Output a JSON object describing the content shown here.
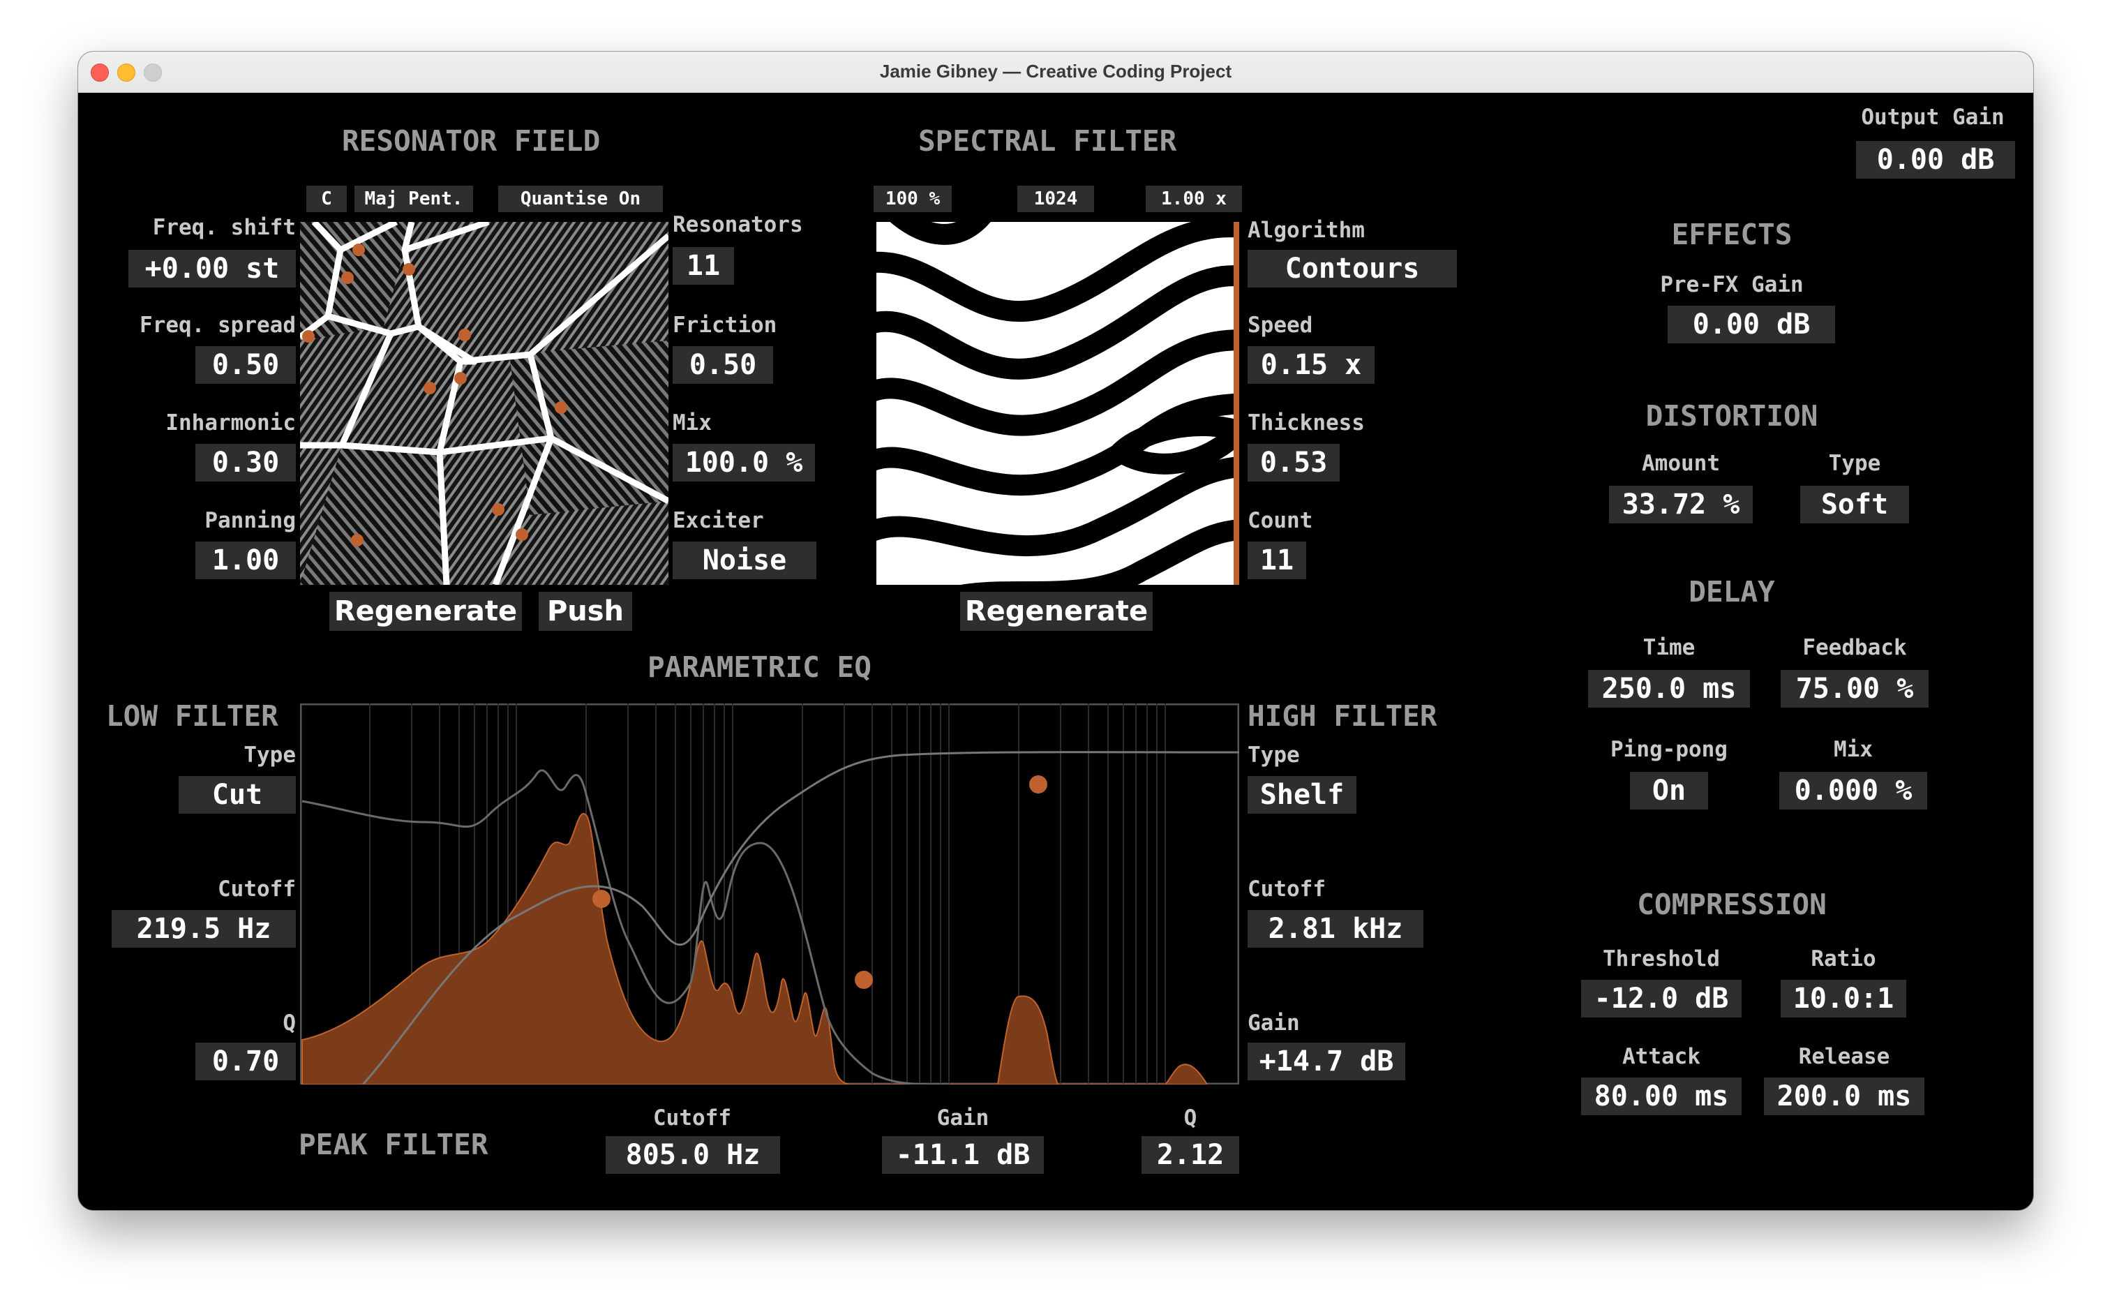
{
  "window": {
    "title": "Jamie Gibney — Creative Coding Project"
  },
  "colors": {
    "accent": "#c0622f",
    "panel": "#2e2e2e",
    "background": "#000000"
  },
  "output": {
    "label": "Output Gain",
    "value": "0.00 dB"
  },
  "resonator": {
    "title": "RESONATOR FIELD",
    "chips": {
      "root": "C",
      "scale": "Maj Pent.",
      "quantise": "Quantise On"
    },
    "freq_shift": {
      "label": "Freq. shift",
      "value": "+0.00 st"
    },
    "freq_spread": {
      "label": "Freq. spread",
      "value": "0.50"
    },
    "inharmonic": {
      "label": "Inharmonic",
      "value": "0.30"
    },
    "panning": {
      "label": "Panning",
      "value": "1.00"
    },
    "resonators": {
      "label": "Resonators",
      "value": "11"
    },
    "friction": {
      "label": "Friction",
      "value": "0.50"
    },
    "mix": {
      "label": "Mix",
      "value": "100.0 %"
    },
    "exciter": {
      "label": "Exciter",
      "value": "Noise"
    },
    "regenerate": "Regenerate",
    "push": "Push"
  },
  "spectral": {
    "title": "SPECTRAL FILTER",
    "chips": {
      "percent": "100 %",
      "size": "1024",
      "multiplier": "1.00 x"
    },
    "algorithm": {
      "label": "Algorithm",
      "value": "Contours"
    },
    "speed": {
      "label": "Speed",
      "value": "0.15 x"
    },
    "thickness": {
      "label": "Thickness",
      "value": "0.53"
    },
    "count": {
      "label": "Count",
      "value": "11"
    },
    "regenerate": "Regenerate"
  },
  "eq": {
    "title": "PARAMETRIC EQ",
    "low": {
      "title": "LOW FILTER",
      "type": {
        "label": "Type",
        "value": "Cut"
      },
      "cutoff": {
        "label": "Cutoff",
        "value": "219.5 Hz"
      },
      "q": {
        "label": "Q",
        "value": "0.70"
      }
    },
    "high": {
      "title": "HIGH FILTER",
      "type": {
        "label": "Type",
        "value": "Shelf"
      },
      "cutoff": {
        "label": "Cutoff",
        "value": "2.81 kHz"
      },
      "gain": {
        "label": "Gain",
        "value": "+14.7 dB"
      }
    },
    "peak": {
      "title": "PEAK FILTER",
      "cutoff": {
        "label": "Cutoff",
        "value": "805.0 Hz"
      },
      "gain": {
        "label": "Gain",
        "value": "-11.1 dB"
      },
      "q": {
        "label": "Q",
        "value": "2.12"
      }
    }
  },
  "effects": {
    "title": "EFFECTS",
    "pre_fx_gain": {
      "label": "Pre-FX Gain",
      "value": "0.00 dB"
    },
    "distortion": {
      "title": "DISTORTION",
      "amount": {
        "label": "Amount",
        "value": "33.72 %"
      },
      "type": {
        "label": "Type",
        "value": "Soft"
      }
    },
    "delay": {
      "title": "DELAY",
      "time": {
        "label": "Time",
        "value": "250.0 ms"
      },
      "feedback": {
        "label": "Feedback",
        "value": "75.00 %"
      },
      "pingpong": {
        "label": "Ping-pong",
        "value": "On"
      },
      "mix": {
        "label": "Mix",
        "value": "0.000 %"
      }
    },
    "compression": {
      "title": "COMPRESSION",
      "threshold": {
        "label": "Threshold",
        "value": "-12.0 dB"
      },
      "ratio": {
        "label": "Ratio",
        "value": "10.0:1"
      },
      "attack": {
        "label": "Attack",
        "value": "80.00 ms"
      },
      "release": {
        "label": "Release",
        "value": "200.0 ms"
      }
    }
  }
}
